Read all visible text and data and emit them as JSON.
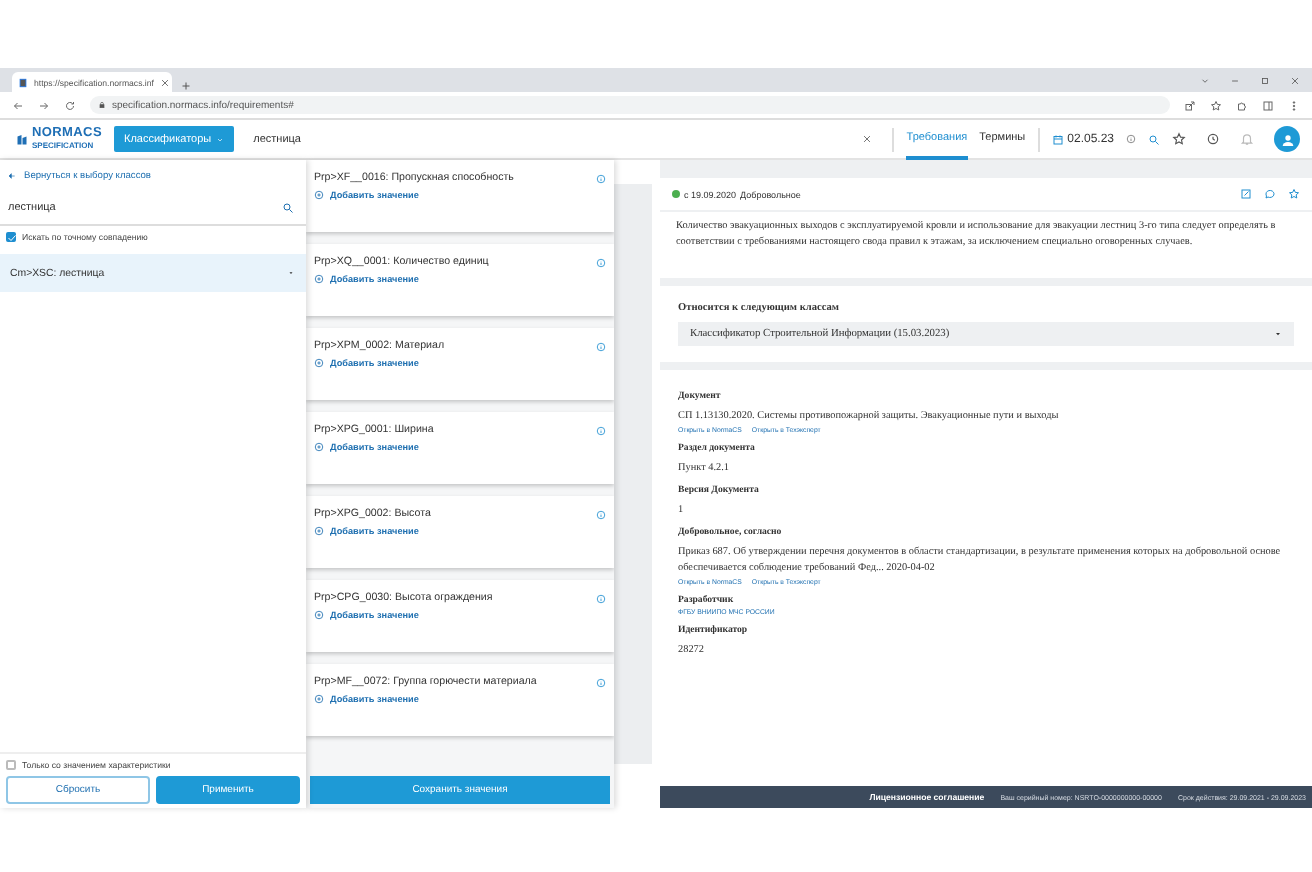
{
  "browser": {
    "tab_title": "https://specification.normacs.inf",
    "url": "specification.normacs.info/requirements#"
  },
  "header": {
    "logo": "NORMACS",
    "logo_sub": "SPECIFICATION",
    "classifiers_button": "Классификаторы",
    "search_value": "лестница",
    "tabs": [
      {
        "label": "Требования",
        "selected": true
      },
      {
        "label": "Термины",
        "selected": false
      }
    ],
    "date": "02.05.23"
  },
  "filter": {
    "back_link": "Вернуться к выбору классов",
    "search_value": "лестница",
    "exact_match": {
      "label": "Искать по точному совпадению",
      "checked": true
    },
    "classes": [
      {
        "label": "Cm>XSC: лестница",
        "selected": true
      }
    ],
    "value_only": {
      "label": "Только со значением характеристики",
      "checked": false
    },
    "buttons": [
      {
        "label": "Сбросить",
        "kind": "secondary"
      },
      {
        "label": "Применить",
        "kind": "primary"
      }
    ]
  },
  "properties": {
    "items": [
      {
        "name": "Prp>XF__0016: Пропускная способность",
        "action": "Добавить значение"
      },
      {
        "name": "Prp>XQ__0001: Количество единиц",
        "action": "Добавить значение"
      },
      {
        "name": "Prp>XPM_0002: Материал",
        "action": "Добавить значение"
      },
      {
        "name": "Prp>XPG_0001: Ширина",
        "action": "Добавить значение"
      },
      {
        "name": "Prp>XPG_0002: Высота",
        "action": "Добавить значение"
      },
      {
        "name": "Prp>CPG_0030: Высота ограждения",
        "action": "Добавить значение"
      },
      {
        "name": "Prp>MF__0072: Группа горючести материала",
        "action": "Добавить значение"
      }
    ],
    "save_button": "Сохранить значения"
  },
  "detail": {
    "date": "с 19.09.2020",
    "status": "Добровольное",
    "description": "Количество эвакуационных выходов с эксплуатируемой кровли и использование для эвакуации лестниц 3-го типа следует определять в соответствии с требованиями настоящего свода правил к этажам, за исключением специально оговоренных случаев.",
    "classes_title": "Относится к следующим классам",
    "classes_select": "Классификатор Строительной Информации (15.03.2023)",
    "fields": [
      {
        "label": "Документ",
        "value": "СП 1.13130.2020. Системы противопожарной защиты. Эвакуационные пути и выходы",
        "links": [
          "Открыть в NormaCS",
          "Открыть в Техэксперт"
        ]
      },
      {
        "label": "Раздел документа",
        "value": "Пункт 4.2.1"
      },
      {
        "label": "Версия Документа",
        "value": "1"
      },
      {
        "label": "Добровольное, согласно",
        "value": "Приказ 687. Об утверждении перечня документов в области стандартизации, в результате применения которых на добровольной основе обеспечивается соблюдение требований Фед... 2020-04-02",
        "links": [
          "Открыть в NormaCS",
          "Открыть в Техэксперт"
        ]
      },
      {
        "label": "Разработчик",
        "links": [
          "ФГБУ ВНИИПО МЧС РОССИИ"
        ]
      },
      {
        "label": "Идентификатор",
        "value": "28272"
      }
    ]
  },
  "footer": {
    "license": "Лицензионное соглашение",
    "serial": "Ваш серийный номер: NSRTO-0000000000-00000",
    "validity": "Срок действия: 29.09.2021 - 29.09.2023"
  }
}
